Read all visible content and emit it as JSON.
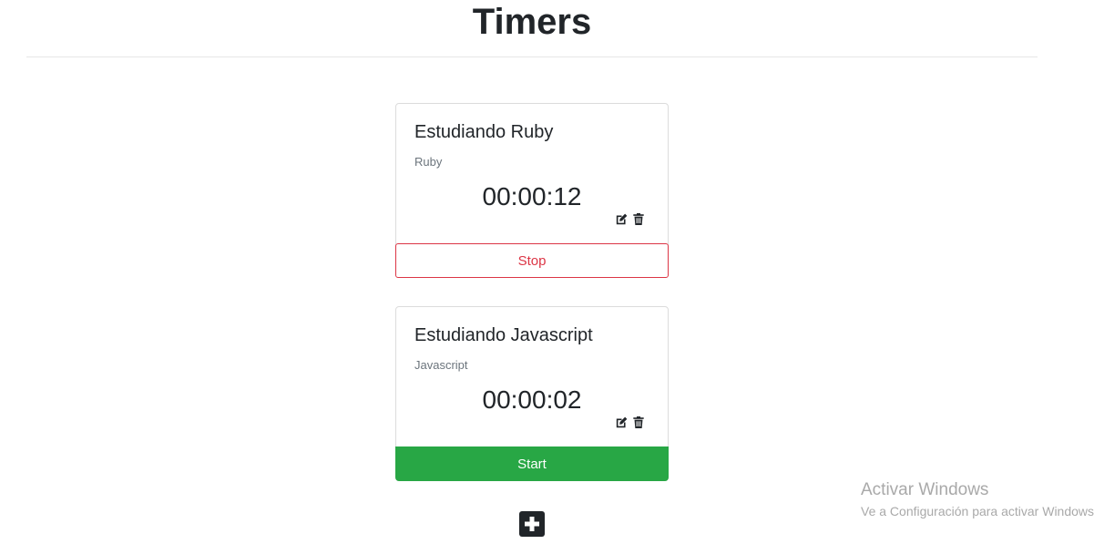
{
  "page": {
    "title": "Timers"
  },
  "timers": [
    {
      "title": "Estudiando Ruby",
      "project": "Ruby",
      "elapsed": "00:00:12",
      "button_label": "Stop",
      "running": true
    },
    {
      "title": "Estudiando Javascript",
      "project": "Javascript",
      "elapsed": "00:00:02",
      "button_label": "Start",
      "running": false
    }
  ],
  "icons": {
    "edit": "edit-icon",
    "delete": "trash-icon",
    "add": "plus-square-icon"
  },
  "colors": {
    "stop": "#dc3545",
    "start": "#28a745",
    "text": "#212529",
    "muted": "#6c757d"
  },
  "watermark": {
    "title": "Activar Windows",
    "subtitle": "Ve a Configuración para activar Windows."
  }
}
